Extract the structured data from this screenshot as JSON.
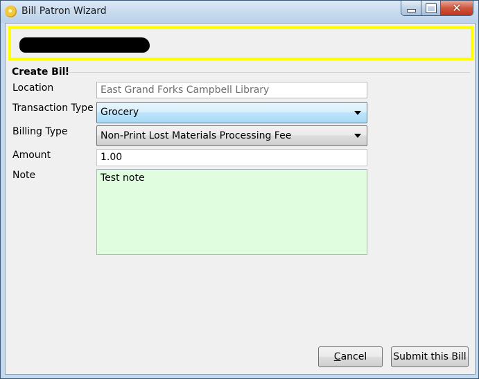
{
  "window": {
    "title": "Bill Patron Wizard",
    "icon": "app-logo-icon",
    "controls": {
      "minimize": "minimize-icon",
      "maximize": "maximize-icon",
      "close_label": "✕"
    }
  },
  "banner": {
    "border_color": "#ffff00",
    "content": "redacted"
  },
  "section": {
    "title": "Create Bill"
  },
  "form": {
    "location": {
      "label": "Location",
      "value": "East Grand Forks Campbell Library"
    },
    "transaction_type": {
      "label": "Transaction Type",
      "value": "Grocery"
    },
    "billing_type": {
      "label": "Billing Type",
      "value": "Non-Print Lost Materials Processing Fee"
    },
    "amount": {
      "label": "Amount",
      "value": "1.00"
    },
    "note": {
      "label": "Note",
      "value": "Test note",
      "background": "#e0fde0"
    }
  },
  "buttons": {
    "cancel": {
      "mnemonic": "C",
      "rest": "ancel"
    },
    "submit": {
      "label": "Submit this Bill"
    }
  }
}
